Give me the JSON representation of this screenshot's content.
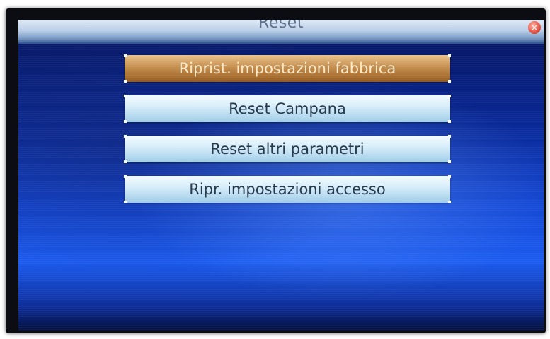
{
  "window": {
    "title": "Reset"
  },
  "close_icon": "×",
  "menu": {
    "items": [
      {
        "label": "Riprist. impostazioni fabbrica",
        "selected": true
      },
      {
        "label": "Reset Campana",
        "selected": false
      },
      {
        "label": "Reset altri parametri",
        "selected": false
      },
      {
        "label": "Ripr. impostazioni accesso",
        "selected": false
      }
    ]
  },
  "colors": {
    "selected_button": "#c89354",
    "button": "#d8eefa",
    "background": "#1448d6"
  }
}
